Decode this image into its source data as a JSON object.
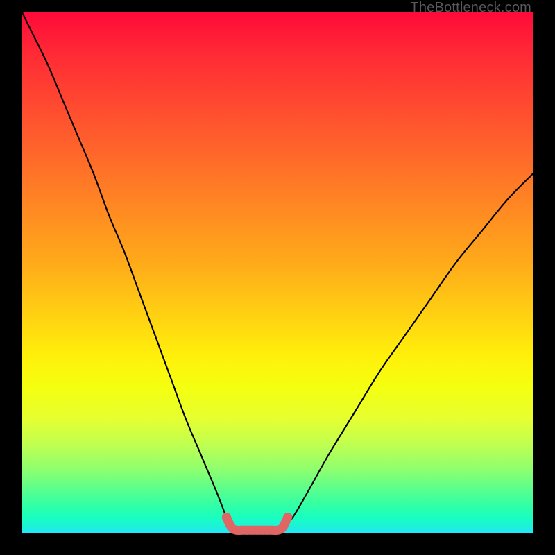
{
  "credit": "TheBottleneck.com",
  "chart_data": {
    "type": "line",
    "title": "",
    "xlabel": "",
    "ylabel": "",
    "xlim": [
      0,
      100
    ],
    "ylim": [
      0,
      100
    ],
    "note": "Axis numbers are not shown in image; x/y expressed as percent of plot width/height. Curve is a V‑shaped bottleneck profile with a flat minimum segment highlighted in salmon.",
    "series": [
      {
        "name": "main-curve",
        "stroke": "#000000",
        "points": [
          {
            "x": 0,
            "y": 100
          },
          {
            "x": 2,
            "y": 96
          },
          {
            "x": 5,
            "y": 90
          },
          {
            "x": 8,
            "y": 83
          },
          {
            "x": 11,
            "y": 76
          },
          {
            "x": 14,
            "y": 69
          },
          {
            "x": 17,
            "y": 61
          },
          {
            "x": 20,
            "y": 54
          },
          {
            "x": 23,
            "y": 46
          },
          {
            "x": 26,
            "y": 38
          },
          {
            "x": 29,
            "y": 30
          },
          {
            "x": 32,
            "y": 22
          },
          {
            "x": 35,
            "y": 15
          },
          {
            "x": 38,
            "y": 8
          },
          {
            "x": 40,
            "y": 3
          },
          {
            "x": 41,
            "y": 1
          },
          {
            "x": 42,
            "y": 0.5
          },
          {
            "x": 50,
            "y": 0.5
          },
          {
            "x": 51,
            "y": 1
          },
          {
            "x": 53,
            "y": 3
          },
          {
            "x": 56,
            "y": 8
          },
          {
            "x": 60,
            "y": 15
          },
          {
            "x": 65,
            "y": 23
          },
          {
            "x": 70,
            "y": 31
          },
          {
            "x": 75,
            "y": 38
          },
          {
            "x": 80,
            "y": 45
          },
          {
            "x": 85,
            "y": 52
          },
          {
            "x": 90,
            "y": 58
          },
          {
            "x": 95,
            "y": 64
          },
          {
            "x": 100,
            "y": 69
          }
        ]
      },
      {
        "name": "flat-minimum-highlight",
        "stroke": "#e06666",
        "thick": true,
        "points": [
          {
            "x": 40,
            "y": 3
          },
          {
            "x": 41,
            "y": 1
          },
          {
            "x": 42,
            "y": 0.5
          },
          {
            "x": 43,
            "y": 0.5
          },
          {
            "x": 44,
            "y": 0.5
          },
          {
            "x": 45,
            "y": 0.5
          },
          {
            "x": 46,
            "y": 0.5
          },
          {
            "x": 47,
            "y": 0.5
          },
          {
            "x": 48,
            "y": 0.5
          },
          {
            "x": 49,
            "y": 0.5
          },
          {
            "x": 50,
            "y": 0.5
          },
          {
            "x": 51,
            "y": 1
          },
          {
            "x": 52,
            "y": 3
          }
        ]
      }
    ]
  }
}
